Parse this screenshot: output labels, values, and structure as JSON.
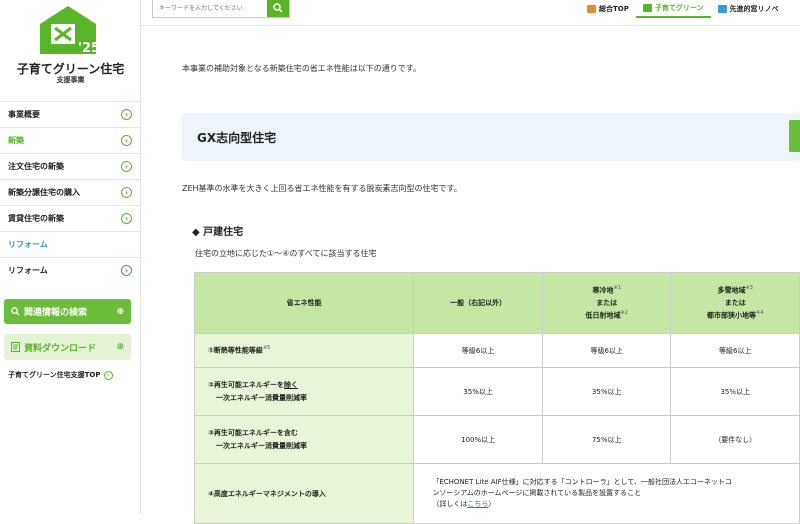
{
  "logo": {
    "year": "25",
    "title": "子育てグリーン住宅",
    "subtitle": "支援事業",
    "brand_color": "#5ab42a"
  },
  "sidebar": {
    "items": [
      {
        "label": "事業概要"
      },
      {
        "label": "新築"
      },
      {
        "label": "注文住宅の新築"
      },
      {
        "label": "新築分譲住宅の購入"
      },
      {
        "label": "賃貸住宅の新築"
      },
      {
        "label": "リフォーム"
      },
      {
        "label": "リフォーム"
      }
    ],
    "search_button": "関連情報の検索",
    "download_button": "資料ダウンロード",
    "top_link": "子育てグリーン住宅支援TOP"
  },
  "search": {
    "placeholder": "キーワードを入力してください"
  },
  "topnav": {
    "items": [
      {
        "label": "総合TOP"
      },
      {
        "label": "子育てグリーン"
      },
      {
        "label": "先進的窓リノベ"
      }
    ]
  },
  "content": {
    "intro": "本事業の補助対象となる新築住宅の省エネ性能は以下の通りです。",
    "gx_title": "GX志向型住宅",
    "zeh_text": "ZEH基準の水準を大きく上回る省エネ性能を有する脱炭素志向型の住宅です。",
    "section_title": "戸建住宅",
    "section_sub": "住宅の立地に応じた①〜④のすべてに該当する住宅"
  },
  "table": {
    "headers": {
      "col0": "省エネ性能",
      "col1": "一般（右記以外）",
      "col2_l1": "寒冷地",
      "col2_n1": "※1",
      "col2_l2": "または",
      "col2_l3": "低日射地域",
      "col2_n3": "※2",
      "col3_l1": "多雪地域",
      "col3_n1": "※3",
      "col3_l2": "または",
      "col3_l3": "都市部狭小地等",
      "col3_n3": "※4"
    },
    "rows": [
      {
        "label": "①断熱等性能等級",
        "note": "※5",
        "c1": "等級6以上",
        "c2": "等級6以上",
        "c3": "等級6以上"
      },
      {
        "label_a": "②再生可能エネルギーを",
        "label_u": "除く",
        "label_b": "一次エネルギー消費量削減率",
        "c1": "35%以上",
        "c2": "35%以上",
        "c3": "35%以上"
      },
      {
        "label_a": "③再生可能エネルギーを含む",
        "label_b": "一次エネルギー消費量削減率",
        "c1": "100%以上",
        "c2": "75%以上",
        "c3": "（要件なし）"
      },
      {
        "label": "④高度エネルギーマネジメントの導入",
        "desc_1": "「ECHONET Lite AIF仕様」に対応する「コントローラ」として、一般社団法人エコーネットコ",
        "desc_2": "ンソーシアムのホームページに掲載されている製品を設置すること",
        "desc_3": "（詳しくは",
        "desc_link": "こちら",
        "desc_4": "）"
      }
    ]
  }
}
